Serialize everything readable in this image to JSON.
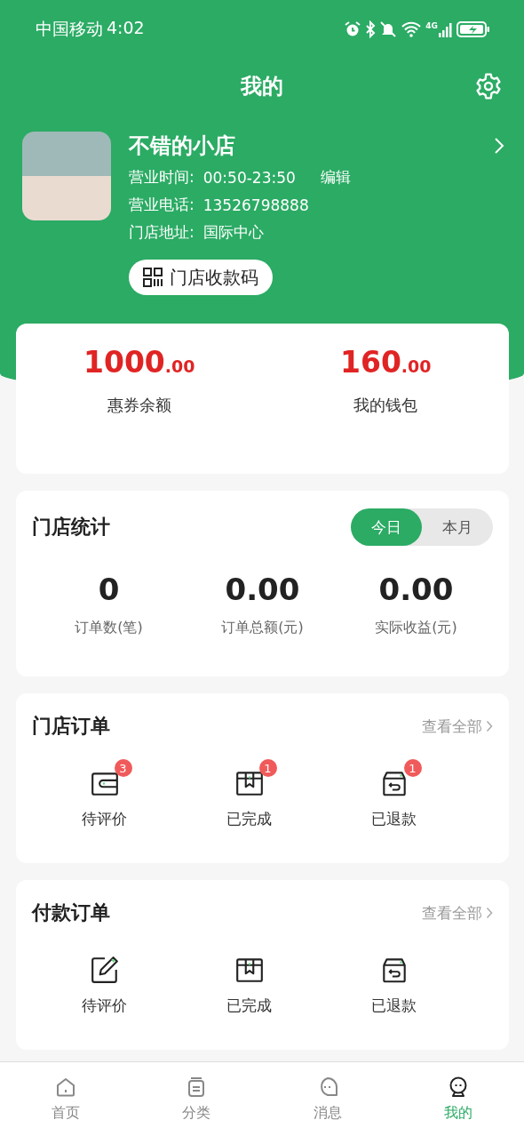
{
  "status_bar": {
    "carrier": "中国移动",
    "time": "4:02",
    "network": "4G"
  },
  "header": {
    "title": "我的"
  },
  "store": {
    "name": "不错的小店",
    "hours_label": "营业时间:",
    "hours": "00:50-23:50",
    "edit": "编辑",
    "phone_label": "营业电话:",
    "phone": "13526798888",
    "address_label": "门店地址:",
    "address": "国际中心",
    "qr_button": "门店收款码"
  },
  "balances": [
    {
      "amount": "1000.00",
      "label": "惠券余额"
    },
    {
      "amount": "160.00",
      "label": "我的钱包"
    }
  ],
  "stats": {
    "title": "门店统计",
    "periods": [
      {
        "label": "今日",
        "selected": true
      },
      {
        "label": "本月",
        "selected": false
      }
    ],
    "items": [
      {
        "value": "0",
        "label": "订单数(笔)"
      },
      {
        "value": "0.00",
        "label": "订单总额(元)"
      },
      {
        "value": "0.00",
        "label": "实际收益(元)"
      }
    ]
  },
  "order_sections": [
    {
      "title": "门店订单",
      "view_all": "查看全部",
      "items": [
        {
          "kind": "wallet",
          "label": "待评价",
          "badge": "3"
        },
        {
          "kind": "box",
          "label": "已完成",
          "badge": "1"
        },
        {
          "kind": "return",
          "label": "已退款",
          "badge": "1"
        }
      ]
    },
    {
      "title": "付款订单",
      "view_all": "查看全部",
      "items": [
        {
          "kind": "edit",
          "label": "待评价"
        },
        {
          "kind": "box",
          "label": "已完成"
        },
        {
          "kind": "return",
          "label": "已退款"
        }
      ]
    }
  ],
  "tab_bar": [
    {
      "kind": "home",
      "label": "首页",
      "selected": false
    },
    {
      "kind": "category",
      "label": "分类",
      "selected": false
    },
    {
      "kind": "message",
      "label": "消息",
      "selected": false
    },
    {
      "kind": "profile",
      "label": "我的",
      "selected": true
    }
  ]
}
